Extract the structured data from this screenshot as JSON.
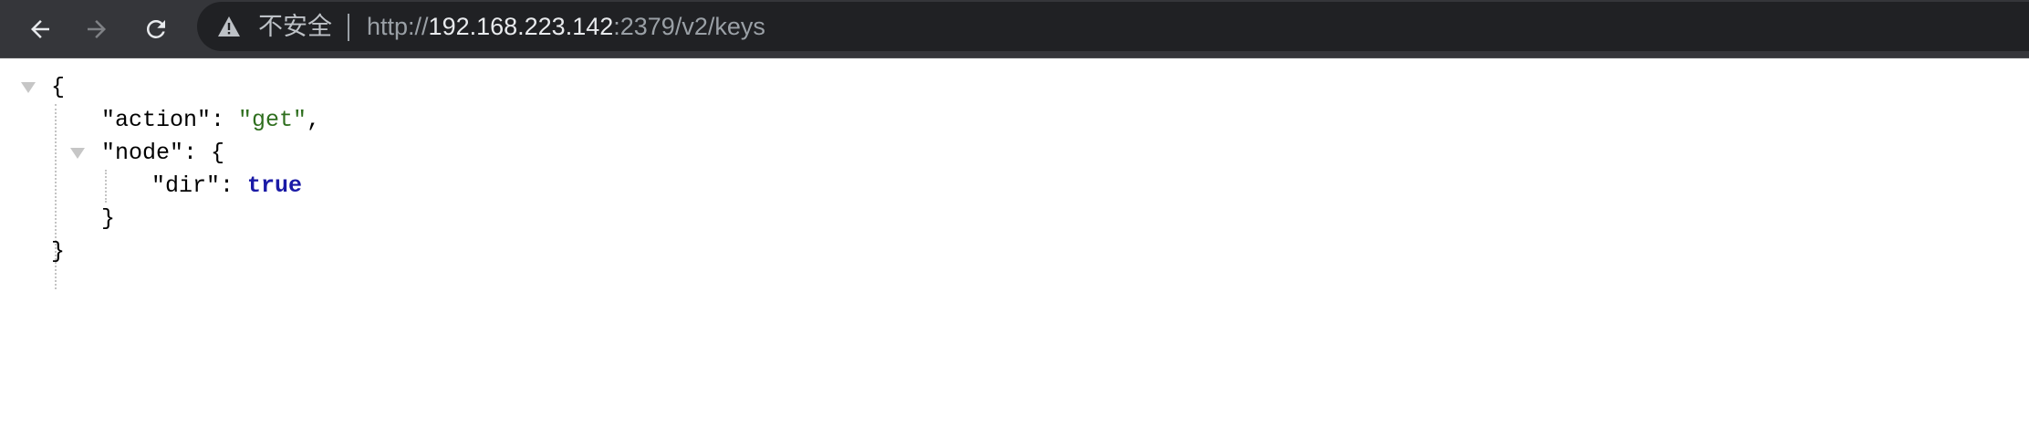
{
  "browser": {
    "nav": {
      "back_icon": "arrow-left-icon",
      "forward_icon": "arrow-right-icon",
      "reload_icon": "reload-icon"
    },
    "omnibox": {
      "security_icon": "warning-triangle-icon",
      "security_label": "不安全",
      "url_scheme": "http://",
      "url_host": "192.168.223.142",
      "url_rest": ":2379/v2/keys"
    }
  },
  "json_viewer": {
    "root_open": "{",
    "root_close": "}",
    "action_key": "\"action\"",
    "action_value": "\"get\"",
    "node_key": "\"node\"",
    "node_open": "{",
    "node_close": "}",
    "dir_key": "\"dir\"",
    "dir_value": "true",
    "colon": ": ",
    "comma": ","
  },
  "colors": {
    "toolbar_bg": "#35363a",
    "omnibox_bg": "#202124",
    "string_value": "#2f6f1f",
    "boolean_value": "#1a1aa6"
  }
}
